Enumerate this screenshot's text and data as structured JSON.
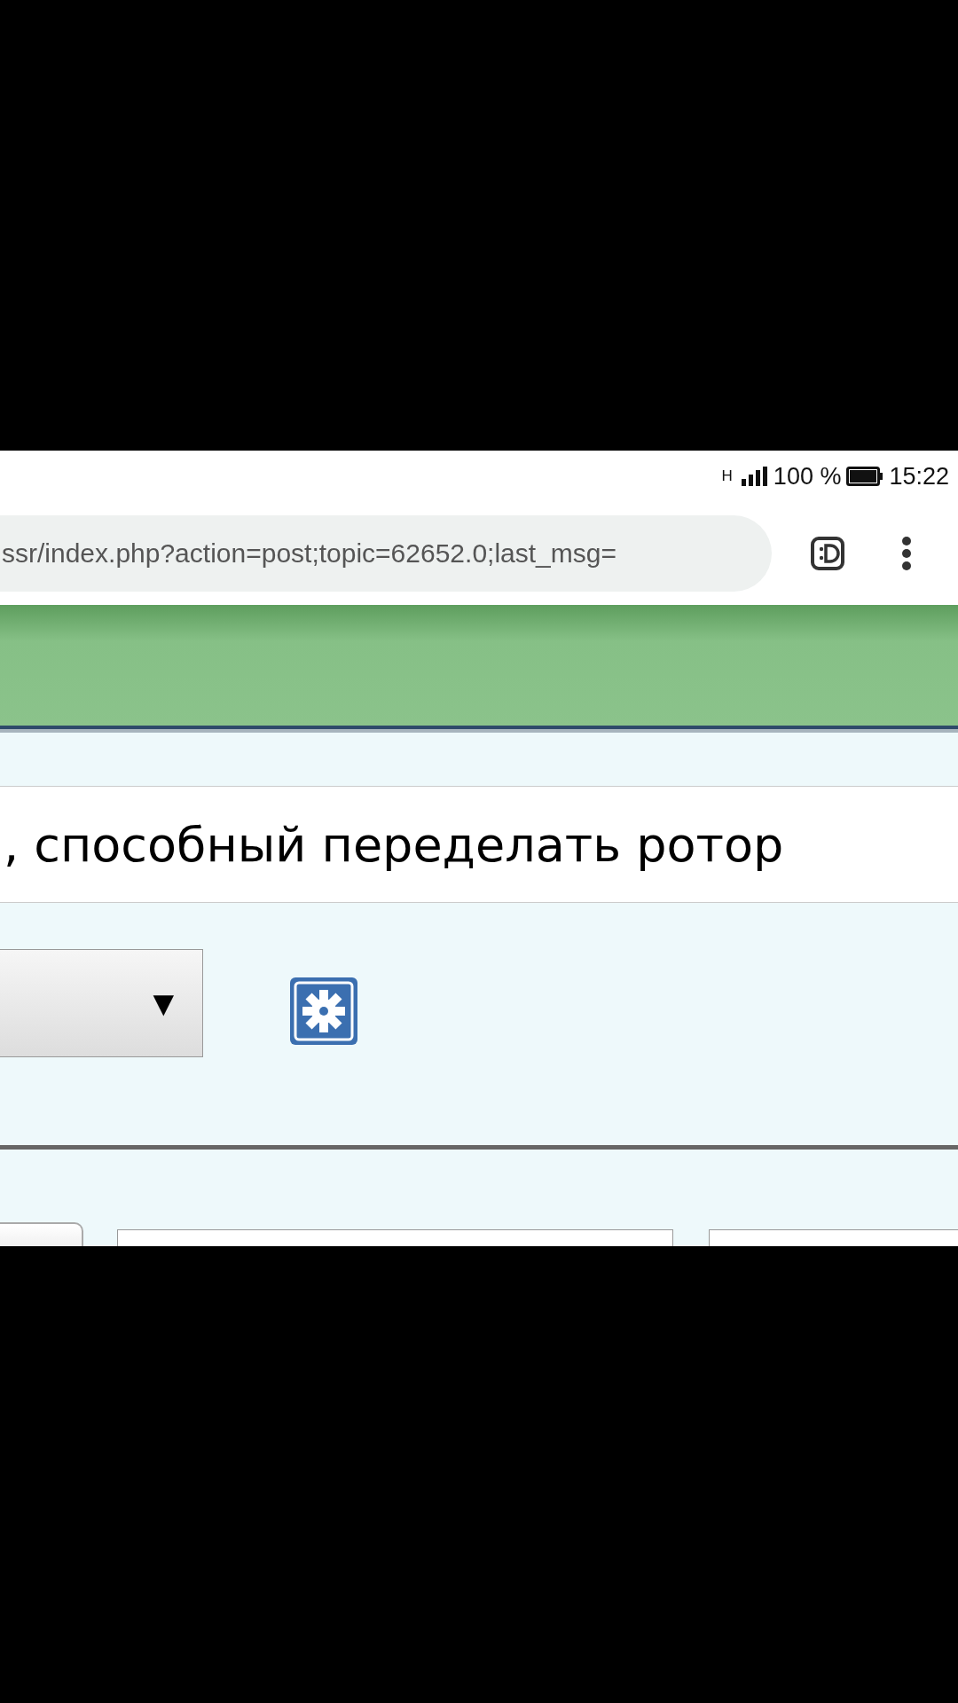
{
  "status_bar": {
    "network": "H",
    "battery": "100 %",
    "time": "15:22"
  },
  "browser": {
    "url": "ssr/index.php?action=post;topic=62652.0;last_msg="
  },
  "post": {
    "subject": ", способный переделать ротор",
    "dropdown_arrow": "▼"
  }
}
